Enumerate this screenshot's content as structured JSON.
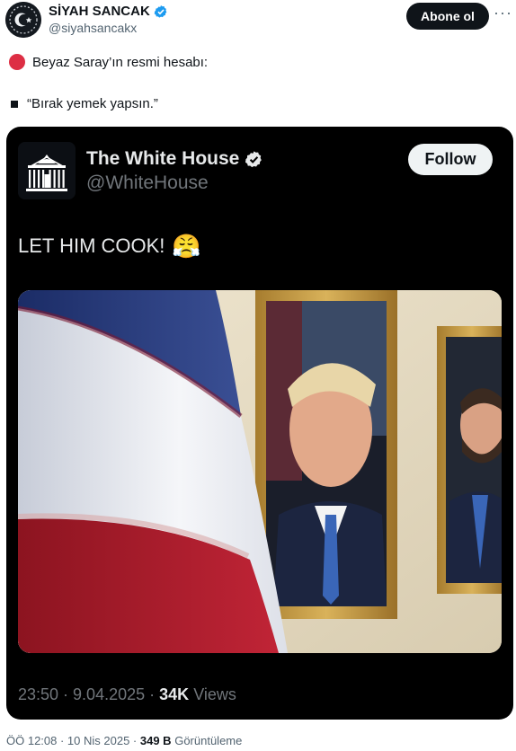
{
  "post": {
    "author_name": "SİYAH SANCAK",
    "author_handle": "@siyahsancakx",
    "follow_label": "Abone ol",
    "more_label": "···",
    "line1": "Beyaz Saray’ın resmi hesabı:",
    "line2": "“Bırak yemek yapsın.”",
    "footer_time": "ÖÖ 12:08 · 10 Nis 2025 ·",
    "footer_views_count": "349 B",
    "footer_views_label": "Görüntüleme"
  },
  "embed": {
    "author_name": "The White House",
    "author_handle": "@WhiteHouse",
    "follow_label": "Follow",
    "text": "LET HIM COOK!",
    "emoji": "😤",
    "meta_time": "23:50 · 9.04.2025 ·",
    "views_count": "34K",
    "views_label": "Views"
  },
  "colors": {
    "verified": "#1d9bf0",
    "red_circle": "#dd2e44",
    "dark_bg": "#000000"
  },
  "icons": [
    "verified-badge-icon",
    "red-circle-icon",
    "black-square-icon",
    "white-house-logo-icon",
    "face-with-steam-icon"
  ]
}
